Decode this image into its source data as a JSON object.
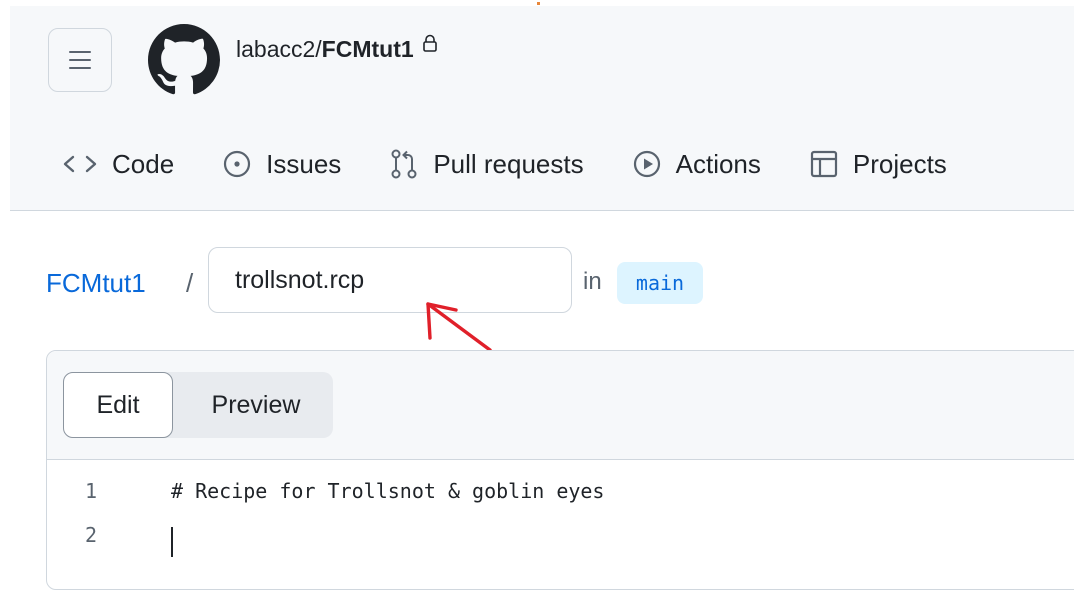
{
  "header": {
    "owner": "labacc2/",
    "repo_name": "FCMtut1",
    "tabs": [
      {
        "label": "Code",
        "icon": "code-icon"
      },
      {
        "label": "Issues",
        "icon": "issue-opened-icon"
      },
      {
        "label": "Pull requests",
        "icon": "git-pull-request-icon"
      },
      {
        "label": "Actions",
        "icon": "play-icon"
      },
      {
        "label": "Projects",
        "icon": "table-icon"
      }
    ]
  },
  "breadcrumb": {
    "repo": "FCMtut1",
    "separator": "/",
    "filename_value": "trollsnot.rcp",
    "in_label": "in",
    "branch": "main"
  },
  "editor": {
    "tab_edit": "Edit",
    "tab_preview": "Preview",
    "lines": [
      {
        "num": "1",
        "text": "# Recipe for Trollsnot & goblin eyes"
      },
      {
        "num": "2",
        "text": ""
      }
    ]
  },
  "colors": {
    "link": "#0969da",
    "annotation_arrow": "#e0202a",
    "branch_bg": "#ddf4ff"
  }
}
